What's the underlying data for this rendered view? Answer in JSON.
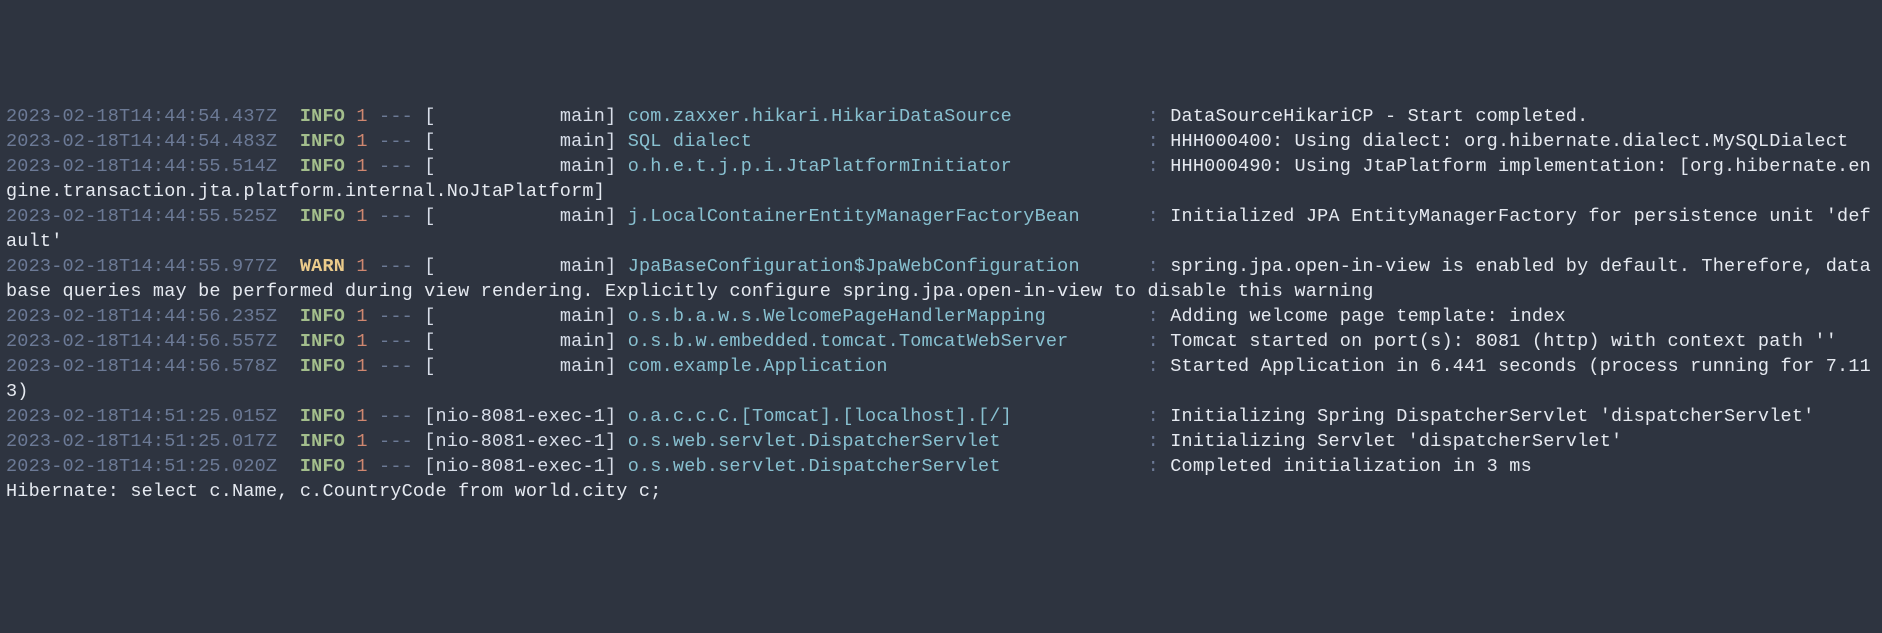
{
  "entries": [
    {
      "ts": "2023-02-18T14:44:54.437Z",
      "level": "INFO",
      "pid": "1",
      "thread": "           main",
      "logger": "com.zaxxer.hikari.HikariDataSource           ",
      "msg": "DataSourceHikariCP - Start completed."
    },
    {
      "ts": "2023-02-18T14:44:54.483Z",
      "level": "INFO",
      "pid": "1",
      "thread": "           main",
      "logger": "SQL dialect                                  ",
      "msg": "HHH000400: Using dialect: org.hibernate.dialect.MySQLDialect"
    },
    {
      "ts": "2023-02-18T14:44:55.514Z",
      "level": "INFO",
      "pid": "1",
      "thread": "           main",
      "logger": "o.h.e.t.j.p.i.JtaPlatformInitiator           ",
      "msg": "HHH000490: Using JtaPlatform implementation: [org.hibernate.engine.transaction.jta.platform.internal.NoJtaPlatform]"
    },
    {
      "ts": "2023-02-18T14:44:55.525Z",
      "level": "INFO",
      "pid": "1",
      "thread": "           main",
      "logger": "j.LocalContainerEntityManagerFactoryBean     ",
      "msg": "Initialized JPA EntityManagerFactory for persistence unit 'default'"
    },
    {
      "ts": "2023-02-18T14:44:55.977Z",
      "level": "WARN",
      "pid": "1",
      "thread": "           main",
      "logger": "JpaBaseConfiguration$JpaWebConfiguration     ",
      "msg": "spring.jpa.open-in-view is enabled by default. Therefore, database queries may be performed during view rendering. Explicitly configure spring.jpa.open-in-view to disable this warning"
    },
    {
      "ts": "2023-02-18T14:44:56.235Z",
      "level": "INFO",
      "pid": "1",
      "thread": "           main",
      "logger": "o.s.b.a.w.s.WelcomePageHandlerMapping        ",
      "msg": "Adding welcome page template: index"
    },
    {
      "ts": "2023-02-18T14:44:56.557Z",
      "level": "INFO",
      "pid": "1",
      "thread": "           main",
      "logger": "o.s.b.w.embedded.tomcat.TomcatWebServer      ",
      "msg": "Tomcat started on port(s): 8081 (http) with context path ''"
    },
    {
      "ts": "2023-02-18T14:44:56.578Z",
      "level": "INFO",
      "pid": "1",
      "thread": "           main",
      "logger": "com.example.Application                      ",
      "msg": "Started Application in 6.441 seconds (process running for 7.113)"
    },
    {
      "ts": "2023-02-18T14:51:25.015Z",
      "level": "INFO",
      "pid": "1",
      "thread": "nio-8081-exec-1",
      "logger": "o.a.c.c.C.[Tomcat].[localhost].[/]           ",
      "msg": "Initializing Spring DispatcherServlet 'dispatcherServlet'"
    },
    {
      "ts": "2023-02-18T14:51:25.017Z",
      "level": "INFO",
      "pid": "1",
      "thread": "nio-8081-exec-1",
      "logger": "o.s.web.servlet.DispatcherServlet            ",
      "msg": "Initializing Servlet 'dispatcherServlet'"
    },
    {
      "ts": "2023-02-18T14:51:25.020Z",
      "level": "INFO",
      "pid": "1",
      "thread": "nio-8081-exec-1",
      "logger": "o.s.web.servlet.DispatcherServlet            ",
      "msg": "Completed initialization in 3 ms"
    }
  ],
  "trailing": "Hibernate: select c.Name, c.CountryCode from world.city c;"
}
